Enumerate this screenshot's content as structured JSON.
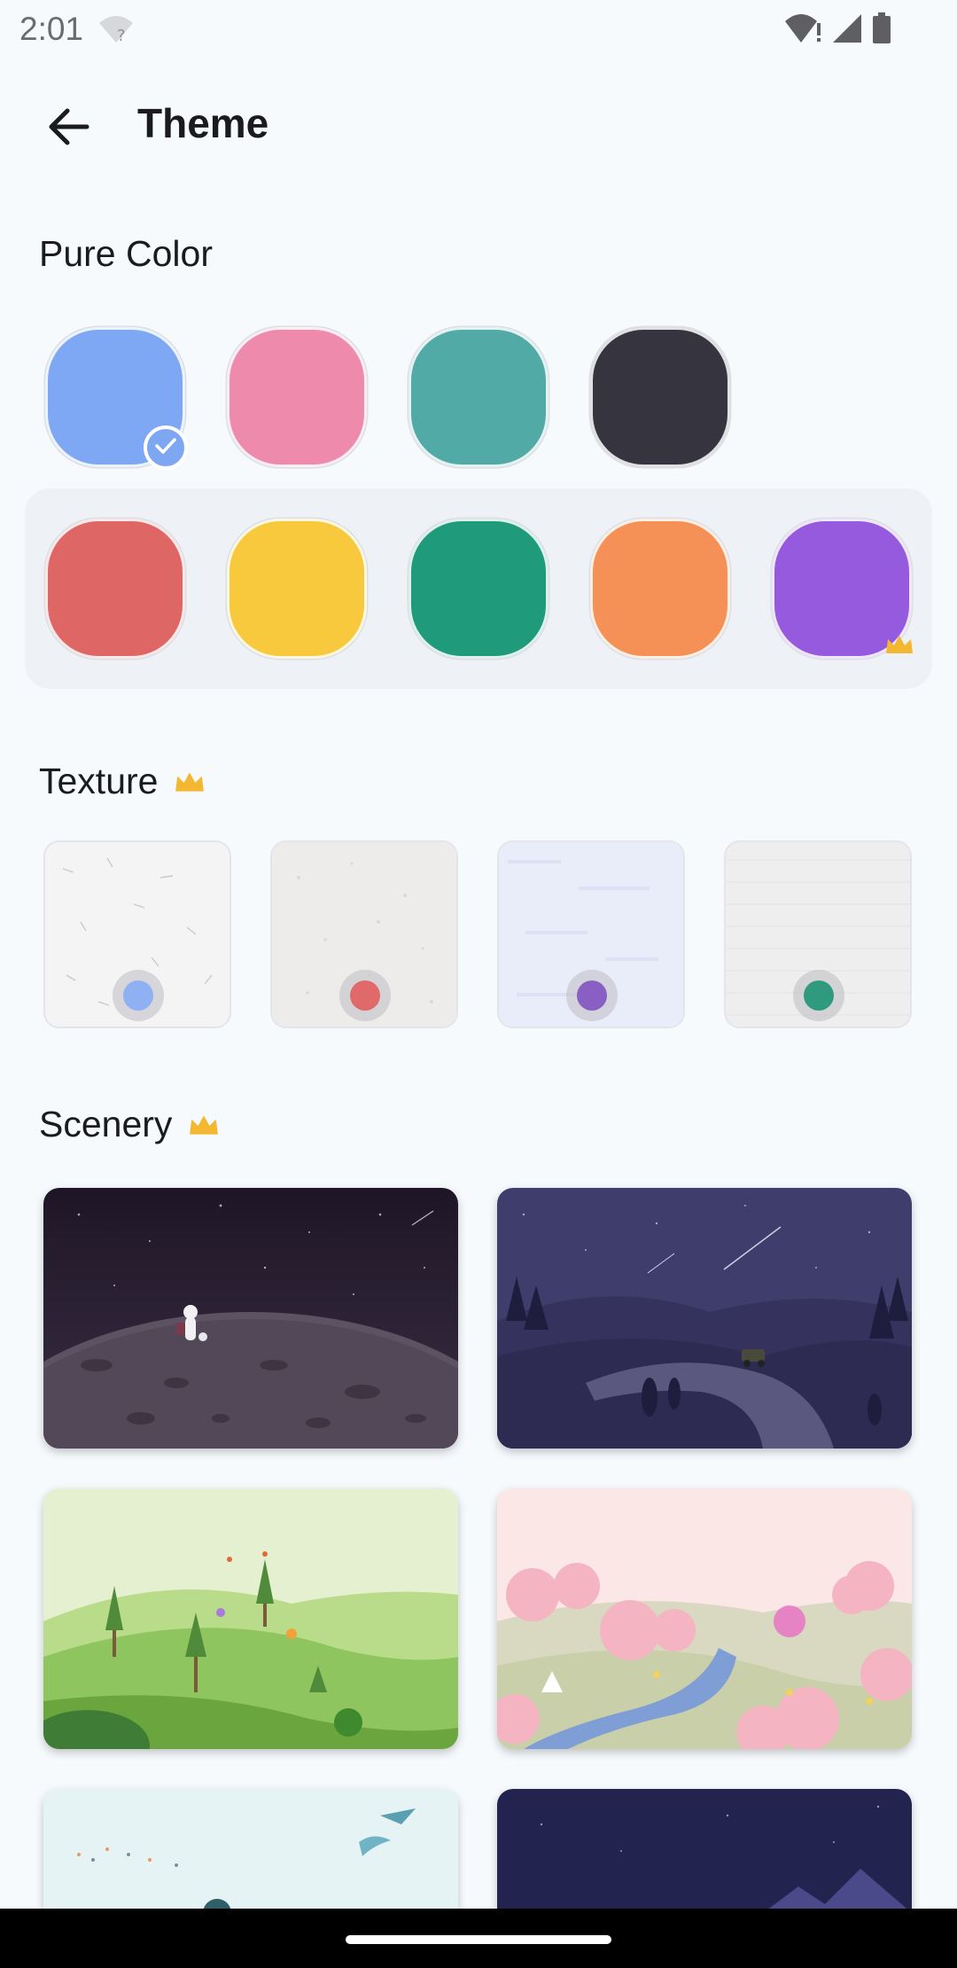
{
  "status_bar": {
    "time": "2:01",
    "icons": [
      "wifi-question-icon",
      "wifi-alert-icon",
      "signal-icon",
      "battery-icon"
    ]
  },
  "app_bar": {
    "title": "Theme",
    "back_icon": "arrow-left-icon"
  },
  "pure_color": {
    "title": "Pure Color",
    "free_colors": [
      {
        "name": "blue",
        "color": "#7fa8f4",
        "selected": true
      },
      {
        "name": "pink",
        "color": "#ee8aab",
        "selected": false
      },
      {
        "name": "teal",
        "color": "#52aaa6",
        "selected": false
      },
      {
        "name": "dark",
        "color": "#36343f",
        "selected": false
      }
    ],
    "premium_colors": [
      {
        "name": "red",
        "color": "#de6664"
      },
      {
        "name": "yellow",
        "color": "#f8c93d"
      },
      {
        "name": "green",
        "color": "#1f9b7b"
      },
      {
        "name": "orange",
        "color": "#f59156"
      },
      {
        "name": "purple",
        "color": "#955ade",
        "crown": true
      }
    ]
  },
  "texture": {
    "title": "Texture",
    "premium_icon": "crown-icon",
    "items": [
      {
        "name": "paper-white",
        "bg": "#f4f4f5",
        "dot": "#8fb0f2"
      },
      {
        "name": "paper-cream",
        "bg": "#eeecea",
        "dot": "#e06a6a"
      },
      {
        "name": "paper-lavender",
        "bg": "#e9ecf9",
        "dot": "#8a5fc3"
      },
      {
        "name": "paper-linen",
        "bg": "#eeeeee",
        "dot": "#2f9a7e"
      }
    ]
  },
  "scenery": {
    "title": "Scenery",
    "premium_icon": "crown-icon",
    "items": [
      {
        "name": "moon-astronaut"
      },
      {
        "name": "night-valley-road"
      },
      {
        "name": "green-meadow"
      },
      {
        "name": "cherry-blossom-valley"
      },
      {
        "name": "sky-birds"
      },
      {
        "name": "night-sky-mountains"
      }
    ]
  },
  "colors": {
    "background": "#f6fafd",
    "crown": "#f3b82f",
    "check_badge": "#7ea7f2"
  }
}
